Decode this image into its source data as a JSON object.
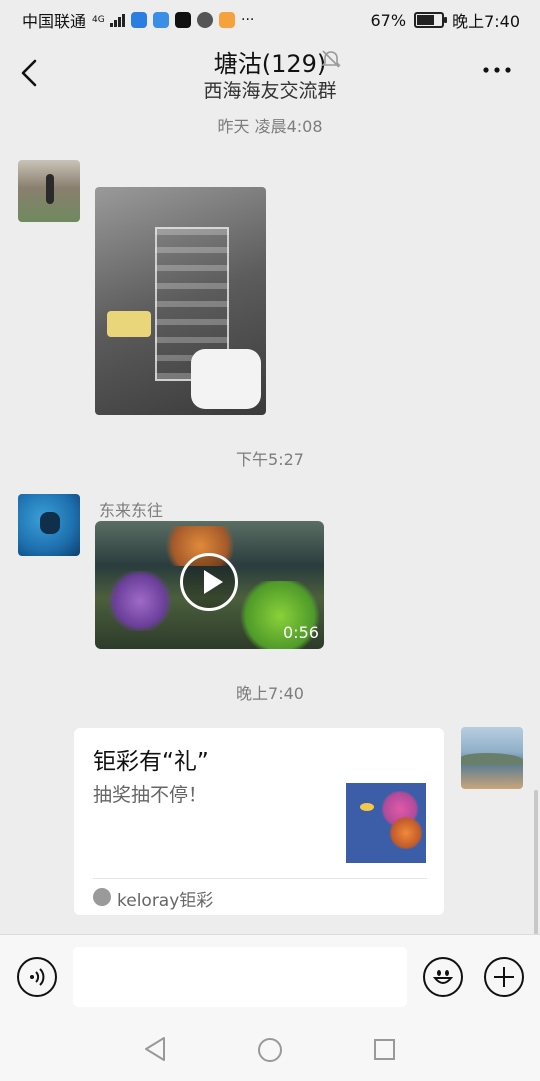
{
  "status_bar": {
    "carrier": "中国联通",
    "network": "4G",
    "battery": "67%",
    "battery_level": 0.67,
    "time": "晚上7:40"
  },
  "header": {
    "title": "塘沽(129)",
    "subtitle": "西海海友交流群"
  },
  "messages": [
    {
      "time": "昨天 凌晨4:08"
    },
    {
      "time": "下午5:27",
      "sender": "东来东往",
      "video_duration": "0:56"
    },
    {
      "time": "晚上7:40"
    }
  ],
  "card": {
    "title": "钜彩有“礼”",
    "description": "抽奖抽不停！",
    "source": "keloray钜彩"
  },
  "icons": {
    "back": "chevron-left-icon",
    "mute": "bell-off-icon",
    "more": "more-icon",
    "voice": "voice-icon",
    "emoji": "emoji-icon",
    "plus": "plus-icon"
  },
  "colors": {
    "background": "#ededed",
    "input_bar": "#f7f7f7",
    "bubble": "#ffffff"
  }
}
